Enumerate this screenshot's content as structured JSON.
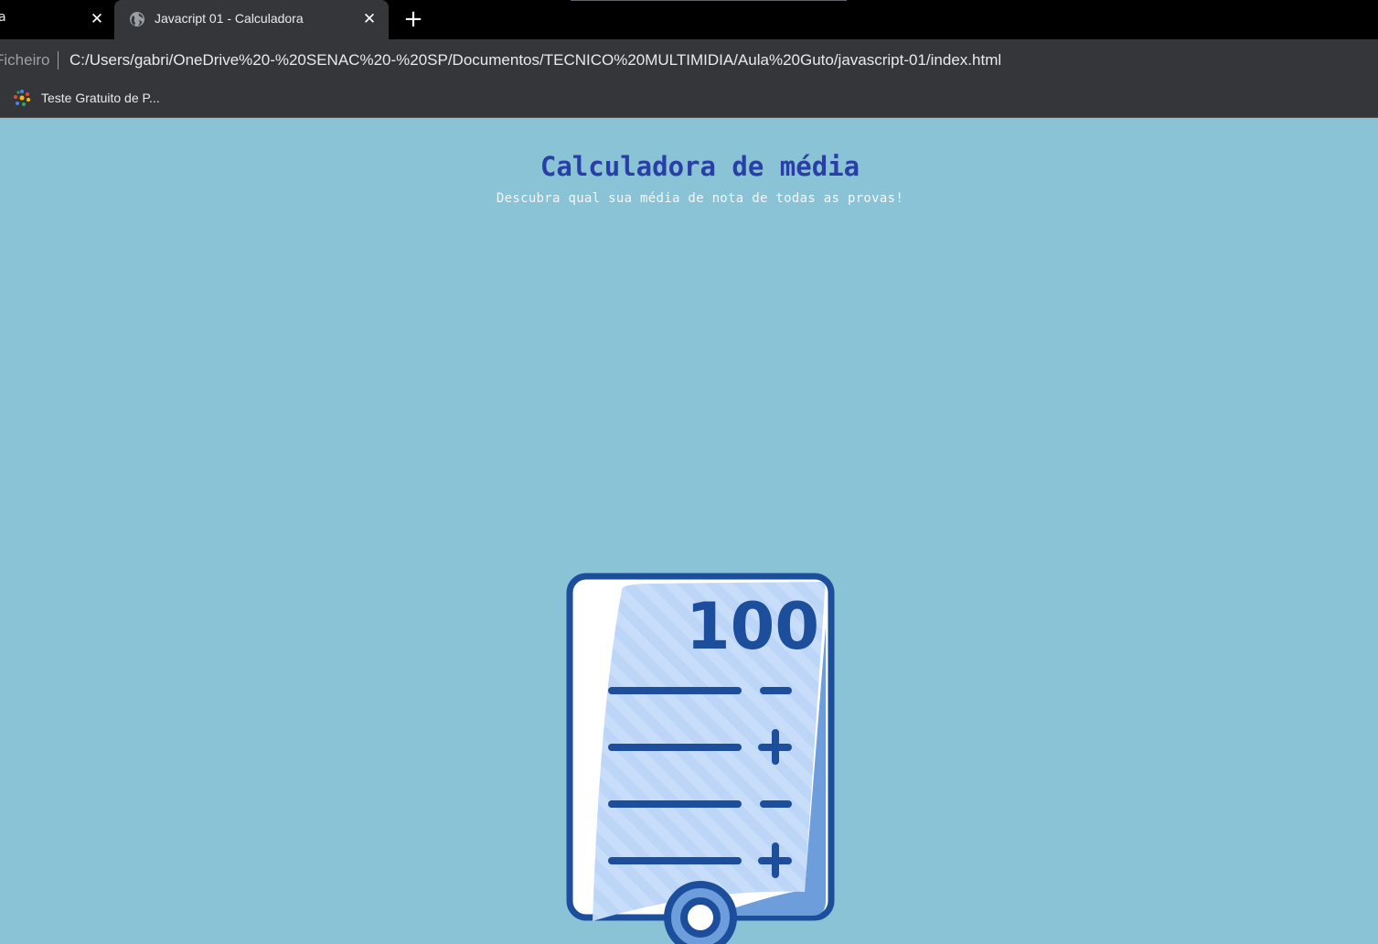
{
  "browser": {
    "tabs": [
      {
        "title": "a",
        "active": false
      },
      {
        "title": "Javacript 01 - Calculadora",
        "active": true
      }
    ],
    "close_glyph": "✕",
    "new_tab_glyph": "+",
    "address": {
      "label": "Ficheiro",
      "url": "C:/Users/gabri/OneDrive%20-%20SENAC%20-%20SP/Documentos/TECNICO%20MULTIMIDIA/Aula%20Guto/javascript-01/index.html"
    },
    "bookmarks": [
      {
        "label": "Teste Gratuito de P...",
        "icon": "colorful-dots-icon"
      }
    ]
  },
  "page": {
    "title": "Calculadora de média",
    "subtitle": "Descubra qual sua média de nota de todas as provas!",
    "illustration": {
      "icon": "grade-sheet-icon",
      "score": "100",
      "rows": [
        "-",
        "+",
        "-",
        "+"
      ],
      "colors": {
        "outline": "#1c4e9c",
        "paper": "#bdd6f8",
        "shade": "#6d9ddb",
        "frame": "#ffffff",
        "background": "#8ac3d6"
      }
    }
  }
}
